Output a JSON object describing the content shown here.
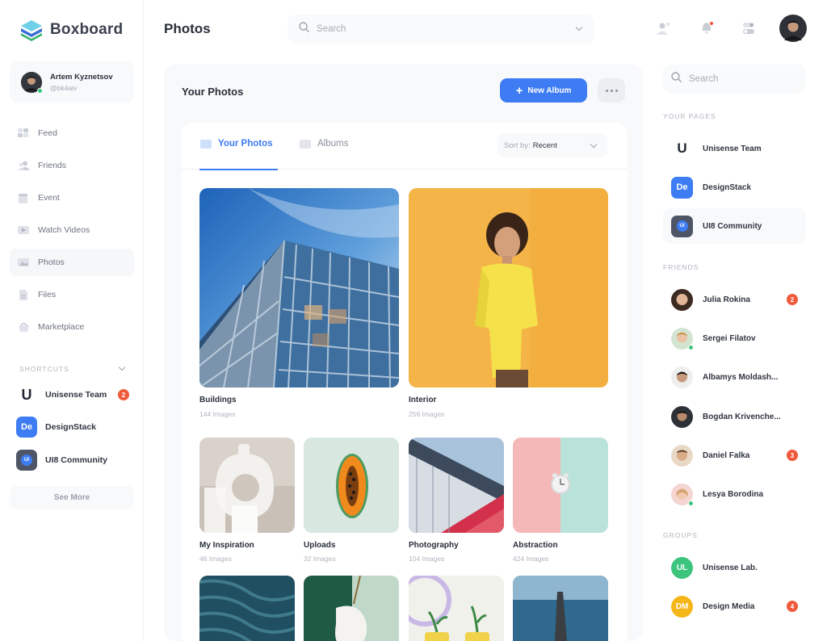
{
  "app": {
    "name": "Boxboard"
  },
  "profile": {
    "name": "Artem Kyznetsov",
    "handle": "@bk4aiv"
  },
  "nav": [
    {
      "label": "Feed",
      "icon": "feed-icon"
    },
    {
      "label": "Friends",
      "icon": "friends-icon"
    },
    {
      "label": "Event",
      "icon": "event-icon"
    },
    {
      "label": "Watch Videos",
      "icon": "video-icon"
    },
    {
      "label": "Photos",
      "icon": "photos-icon",
      "active": true
    },
    {
      "label": "Files",
      "icon": "files-icon"
    },
    {
      "label": "Marketplace",
      "icon": "marketplace-icon"
    }
  ],
  "shortcuts": {
    "label": "SHORTCUTS",
    "items": [
      {
        "label": "Unisense Team",
        "badge": "2"
      },
      {
        "label": "DesignStack",
        "mark": "De"
      },
      {
        "label": "UI8 Community",
        "mark": "UI"
      }
    ],
    "see_more": "See More"
  },
  "header": {
    "title": "Photos",
    "search_placeholder": "Search"
  },
  "main": {
    "title": "Your Photos",
    "new_album": "New Album",
    "tabs": [
      {
        "label": "Your Photos",
        "active": true
      },
      {
        "label": "Albums"
      }
    ],
    "sort": {
      "prefix": "Sort by:",
      "value": "Recent"
    },
    "albums": [
      {
        "title": "Buildings",
        "count": "144 Images"
      },
      {
        "title": "Interior",
        "count": "256 Images"
      },
      {
        "title": "My Inspiration",
        "count": "46 Images"
      },
      {
        "title": "Uploads",
        "count": "32 Images"
      },
      {
        "title": "Photography",
        "count": "104 Images"
      },
      {
        "title": "Abstraction",
        "count": "424 Images"
      }
    ]
  },
  "right": {
    "search_placeholder": "Search",
    "pages_label": "YOUR PAGES",
    "pages": [
      {
        "label": "Unisense Team"
      },
      {
        "label": "DesignStack",
        "mark": "De"
      },
      {
        "label": "UI8 Community",
        "mark": "UI"
      }
    ],
    "friends_label": "FRIENDS",
    "friends": [
      {
        "name": "Julia Rokina",
        "badge": "2"
      },
      {
        "name": "Sergei Filatov"
      },
      {
        "name": "Albamys Moldash..."
      },
      {
        "name": "Bogdan Krivenche..."
      },
      {
        "name": "Daniel Falka",
        "badge": "3"
      },
      {
        "name": "Lesya Borodina"
      }
    ],
    "groups_label": "GROUPS",
    "groups": [
      {
        "name": "Unisense Lab.",
        "initials": "UL",
        "color": "#3cc47c"
      },
      {
        "name": "Design Media",
        "initials": "DM",
        "color": "#f5b61a",
        "badge": "4"
      }
    ]
  },
  "colors": {
    "accent": "#3d7cf2",
    "badge": "#f05a3c",
    "online": "#3cc47c"
  }
}
